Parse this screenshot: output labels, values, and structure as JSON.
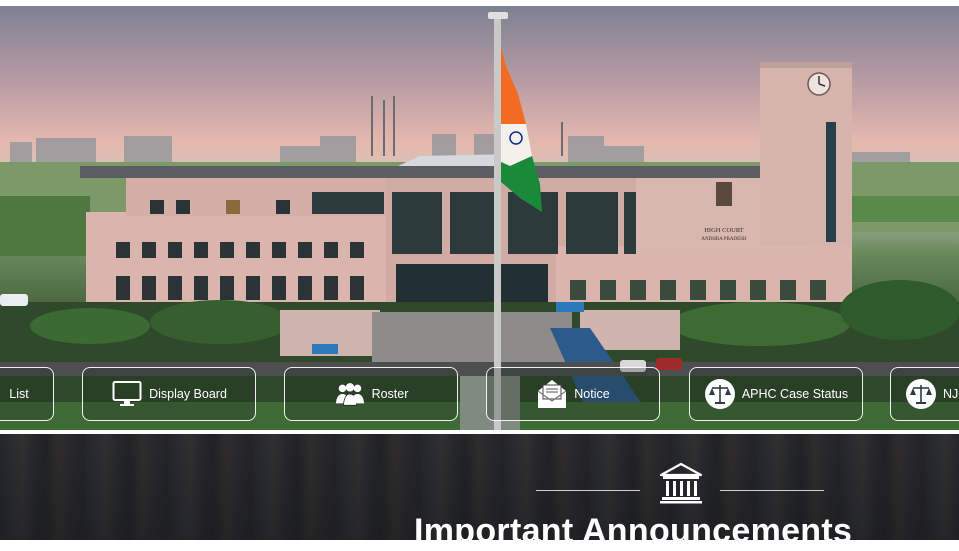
{
  "hero": {
    "building_sign": [
      "HIGH COURT",
      "ANDHRA PRADESH"
    ]
  },
  "quick_links": [
    {
      "label": "List",
      "icon": "list-icon"
    },
    {
      "label": "Display Board",
      "icon": "monitor-icon"
    },
    {
      "label": "Roster",
      "icon": "people-group-icon"
    },
    {
      "label": "Notice",
      "icon": "envelope-open-icon"
    },
    {
      "label": "APHC Case Status",
      "icon": "scales-of-justice-icon"
    },
    {
      "label": "NJ",
      "icon": "scales-of-justice-icon"
    }
  ],
  "announcements": {
    "title": "Important Announcements",
    "icon": "courthouse-icon"
  },
  "colors": {
    "flag_saffron": "#f26b22",
    "flag_green": "#1a8a3a",
    "flag_navy": "#0a2a8a",
    "building_stone": "#d9b5ae",
    "glass": "#2c3a3c"
  }
}
